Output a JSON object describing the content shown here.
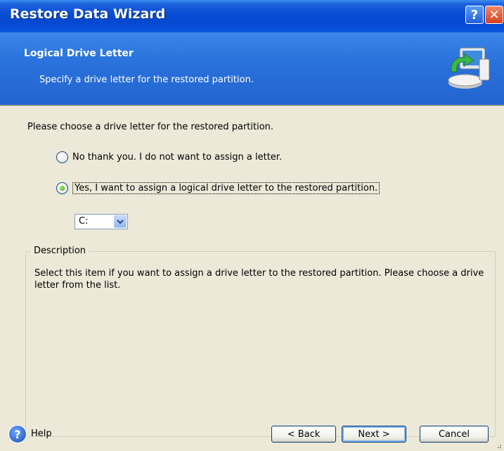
{
  "window": {
    "title": "Restore Data Wizard",
    "help_glyph": "?",
    "close_glyph": "✕"
  },
  "header": {
    "title": "Logical Drive Letter",
    "subtitle": "Specify a drive letter for the restored partition.",
    "icon": "restore-computer-icon"
  },
  "main": {
    "prompt": "Please choose a drive letter for the restored partition.",
    "options": [
      {
        "label": "No thank you. I do not want to assign a letter.",
        "checked": false
      },
      {
        "label": "Yes, I want to assign a logical drive letter to the restored partition.",
        "checked": true
      }
    ],
    "drive_select": {
      "value": "C:"
    }
  },
  "description": {
    "legend": "Description",
    "text": "Select this item if you want to assign a drive letter to the restored partition. Please choose a drive letter from the list."
  },
  "footer": {
    "help_label": "Help",
    "help_glyph": "?",
    "back_label": "< Back",
    "next_label": "Next >",
    "cancel_label": "Cancel"
  },
  "colors": {
    "title_bar": "#0548d0",
    "header_bg": "#2a72dc",
    "window_bg": "#ece9d8"
  }
}
